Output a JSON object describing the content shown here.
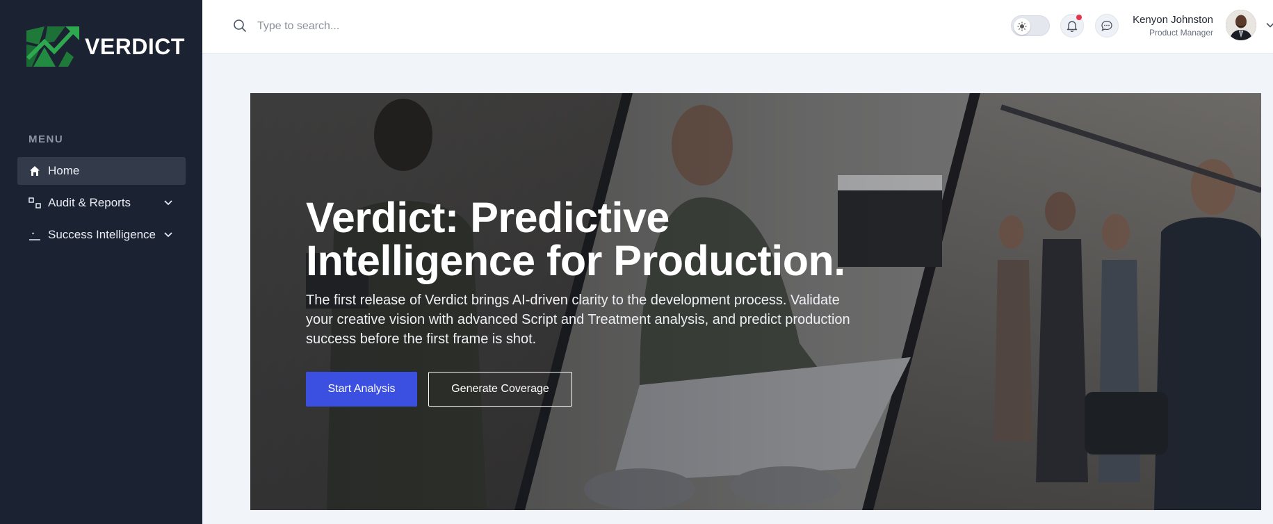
{
  "brand": {
    "name": "VERDICT",
    "logo_icon": "verdict-logo-icon",
    "color": "#1f7a3a"
  },
  "sidebar": {
    "menu_label": "MENU",
    "items": [
      {
        "label": "Home",
        "icon": "home-icon",
        "active": true
      },
      {
        "label": "Audit & Reports",
        "icon": "reports-icon",
        "expandable": true
      },
      {
        "label": "Success Intelligence",
        "icon": "chart-icon",
        "expandable": true
      }
    ]
  },
  "header": {
    "search": {
      "placeholder": "Type to search..."
    },
    "theme_toggle": {
      "icon": "sun-icon",
      "state": "light"
    },
    "notifications": {
      "icon": "bell-icon",
      "has_unread": true
    },
    "messages": {
      "icon": "chat-icon"
    },
    "user": {
      "name": "Kenyon Johnston",
      "role": "Product Manager"
    }
  },
  "hero": {
    "title_line1": "Verdict: Predictive",
    "title_line2": "Intelligence for Production.",
    "description": "The first release of Verdict brings AI-driven clarity to the development process. Validate your creative vision with advanced Script and Treatment analysis, and predict production success before the first frame is shot.",
    "primary_button": "Start Analysis",
    "secondary_button": "Generate Coverage"
  },
  "colors": {
    "sidebar_bg": "#1b2232",
    "accent": "#3b50e0",
    "notification": "#e5334b"
  }
}
